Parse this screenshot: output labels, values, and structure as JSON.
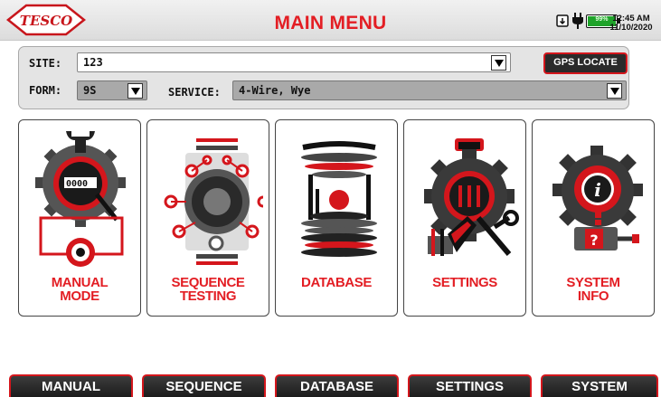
{
  "header": {
    "logo_text": "TESCO",
    "title": "MAIN MENU",
    "battery_percent": "99%",
    "battery_level": 0.99,
    "time": "12:45 AM",
    "date": "11/10/2020",
    "icons": [
      "sd-card-icon",
      "plug-icon",
      "battery-icon"
    ]
  },
  "form": {
    "site_label": "SITE:",
    "site_value": "123",
    "gps_button": "GPS LOCATE",
    "form_label": "FORM:",
    "form_value": "9S",
    "service_label": "SERVICE:",
    "service_value": "4-Wire, Wye"
  },
  "tiles": [
    {
      "line1": "MANUAL",
      "line2": "MODE",
      "icon": "meter-gear-icon"
    },
    {
      "line1": "SEQUENCE",
      "line2": "TESTING",
      "icon": "sequence-gear-icon"
    },
    {
      "line1": "DATABASE",
      "line2": "",
      "icon": "database-icon"
    },
    {
      "line1": "SETTINGS",
      "line2": "",
      "icon": "settings-gear-icon"
    },
    {
      "line1": "SYSTEM",
      "line2": "INFO",
      "icon": "info-gear-icon"
    }
  ],
  "nav": [
    "MANUAL",
    "SEQUENCE",
    "DATABASE",
    "SETTINGS",
    "SYSTEM"
  ],
  "colors": {
    "accent": "#e31e24",
    "dark": "#2a2a2a",
    "panel": "#e4e4e4",
    "battery": "#1fa32a"
  }
}
